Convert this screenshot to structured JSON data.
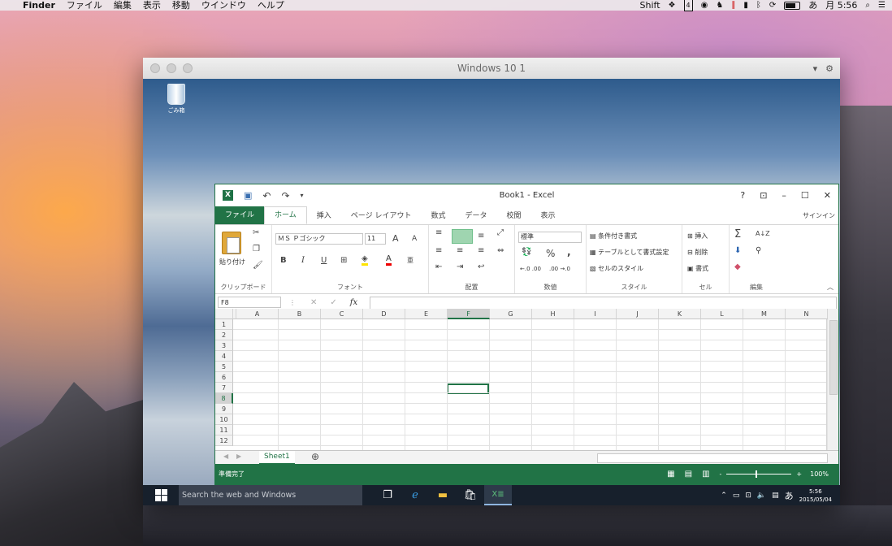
{
  "mac_menubar": {
    "apple": "",
    "app": "Finder",
    "items": [
      "ファイル",
      "編集",
      "表示",
      "移動",
      "ウインドウ",
      "ヘルプ"
    ],
    "right": {
      "shift": "Shift",
      "badge": "4",
      "ime": "あ",
      "clock": "月 5:56"
    }
  },
  "vm": {
    "title": "Windows 10 1",
    "dropdown": "▾",
    "gear": "⚙"
  },
  "desktop": {
    "recycle_label": "ごみ箱"
  },
  "excel": {
    "title": "Book1 - Excel",
    "qat": {
      "logo": "X",
      "save": "💾",
      "undo": "↶",
      "redo": "↷",
      "more": "▾"
    },
    "window_controls": {
      "help": "?",
      "restore_ribbon": "⊡",
      "min": "–",
      "max": "☐",
      "close": "✕"
    },
    "tabs": [
      "ファイル",
      "ホーム",
      "挿入",
      "ページ レイアウト",
      "数式",
      "データ",
      "校閲",
      "表示"
    ],
    "active_tab": "ホーム",
    "signin": "サインイン",
    "ribbon": {
      "clipboard": {
        "label": "クリップボード",
        "paste": "貼り付け"
      },
      "font": {
        "label": "フォント",
        "name": "ＭＳ Ｐゴシック",
        "size": "11",
        "bold": "B",
        "italic": "I",
        "underline": "U",
        "grow": "A",
        "shrink": "A"
      },
      "alignment": {
        "label": "配置"
      },
      "number": {
        "label": "数値",
        "format": "標準",
        "percent": "%",
        "comma": ",",
        "inc": "←.0 .00",
        "dec": ".00 →.0"
      },
      "styles": {
        "label": "スタイル",
        "conditional": "条件付き書式",
        "table": "テーブルとして書式設定",
        "cell": "セルのスタイル"
      },
      "cells": {
        "label": "セル",
        "insert": "挿入",
        "delete": "削除",
        "format": "書式"
      },
      "editing": {
        "label": "編集",
        "sum": "Σ",
        "sort": "A↓Z",
        "find": "🔍",
        "clear": "◇"
      }
    },
    "namebox": "F8",
    "fx": "fx",
    "columns": [
      "A",
      "B",
      "C",
      "D",
      "E",
      "F",
      "G",
      "H",
      "I",
      "J",
      "K",
      "L",
      "M",
      "N"
    ],
    "selected_col": "F",
    "rows": [
      "1",
      "2",
      "3",
      "4",
      "5",
      "6",
      "7",
      "8",
      "9",
      "10",
      "11",
      "12"
    ],
    "selected_row": "8",
    "sheet_tab": "Sheet1",
    "add_sheet": "⊕",
    "status": {
      "ready": "準備完了",
      "zoom": "100%",
      "minus": "-",
      "plus": "+"
    }
  },
  "taskbar": {
    "search_placeholder": "Search the web and Windows",
    "time": "5:56",
    "date": "2015/05/04",
    "ime": "あ"
  }
}
